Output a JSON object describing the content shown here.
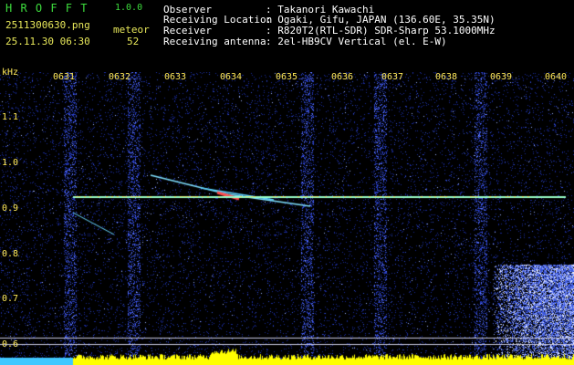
{
  "app": {
    "title": "H R O F F T",
    "version": "1.0.0"
  },
  "file": {
    "name": "2511300630.png",
    "datetime": "25.11.30 06:30"
  },
  "detection": {
    "label": "meteor",
    "count": "52"
  },
  "info": [
    {
      "key": "Observer",
      "value": ": Takanori Kawachi"
    },
    {
      "key": "Receiving Location",
      "value": ": Ogaki, Gifu, JAPAN (136.60E, 35.35N)"
    },
    {
      "key": "Receiver",
      "value": ": R820T2(RTL-SDR) SDR-Sharp 53.1000MHz"
    },
    {
      "key": "Receiving antenna",
      "value": ": 2el-HB9CV Vertical (el. E-W)"
    }
  ],
  "axis": {
    "unit": "kHz",
    "time_ticks": [
      "0631",
      "0632",
      "0633",
      "0634",
      "0635",
      "0636",
      "0637",
      "0638",
      "0639",
      "0640"
    ],
    "freq_ticks": [
      "1.1",
      "1.0",
      "0.9",
      "0.8",
      "0.7",
      "0.6"
    ]
  },
  "colors": {
    "background": "#000000",
    "noise": "#1a2fb0",
    "label": "#ffe95a",
    "title": "#3ddc3d",
    "signal": "#ffff00"
  }
}
